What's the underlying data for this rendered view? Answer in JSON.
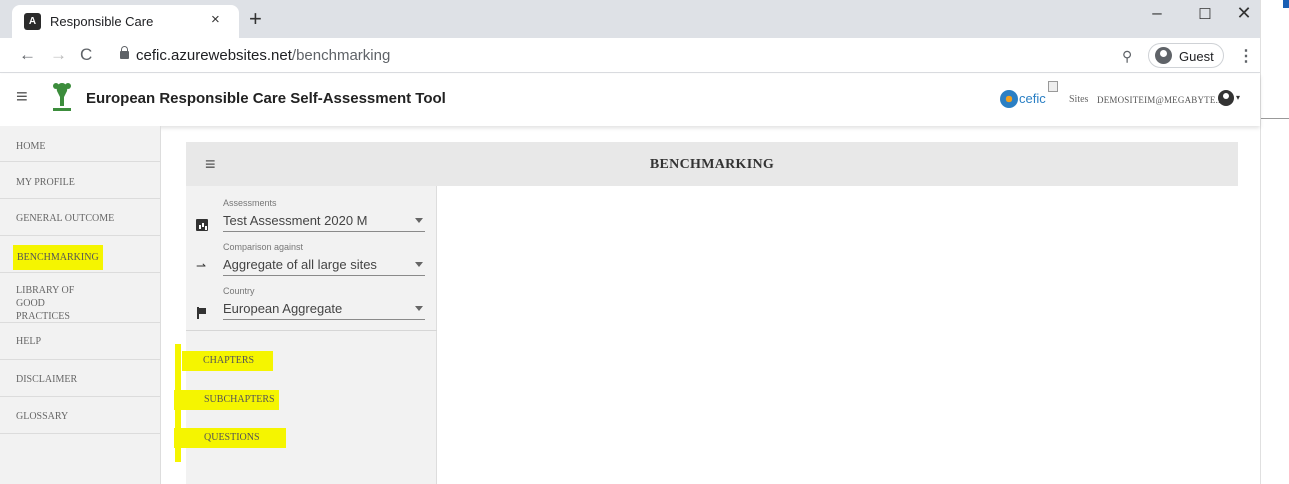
{
  "browser": {
    "tab_title": "Responsible Care",
    "tab_close": "×",
    "new_tab": "+",
    "url_host": "cefic.azurewebsites.net",
    "url_path": "/benchmarking",
    "profile_label": "Guest",
    "controls": {
      "minimize": "–",
      "maximize": "☐",
      "close": "✕",
      "back": "←",
      "forward": "→",
      "reload": "C",
      "zoom": "🔍",
      "menu": "⋮"
    }
  },
  "header": {
    "menu_icon": "≡",
    "title": "European Responsible Care Self-Assessment Tool",
    "cefic_text": "cefic",
    "sites_label": "Sites",
    "user_email": "DEMOSITEIM@MEGABYTE.BE",
    "user_caret": "▾"
  },
  "sidebar": {
    "items": [
      {
        "label": "HOME"
      },
      {
        "label": "MY PROFILE"
      },
      {
        "label": "GENERAL OUTCOME"
      },
      {
        "label": "BENCHMARKING",
        "active": true
      },
      {
        "label": "LIBRARY OF GOOD PRACTICES"
      },
      {
        "label": "HELP"
      },
      {
        "label": "DISCLAIMER"
      },
      {
        "label": "GLOSSARY"
      }
    ]
  },
  "main": {
    "menu_icon": "≡",
    "title": "BENCHMARKING",
    "filters": {
      "assessments": {
        "label": "Assessments",
        "value": "Test Assessment 2020 M",
        "icon": "chart-icon"
      },
      "comparison": {
        "label": "Comparison against",
        "value": "Aggregate of all large sites",
        "icon": "compare-arrows-icon",
        "glyph": "⇀"
      },
      "country": {
        "label": "Country",
        "value": "European Aggregate",
        "icon": "flag-icon"
      }
    },
    "links": {
      "chapters": "CHAPTERS",
      "subchapters": "SUBCHAPTERS",
      "questions": "QUESTIONS"
    }
  },
  "colors": {
    "highlight": "#f5f500",
    "sidebar_bg": "#f2f2f2",
    "title_bar_bg": "#e8e8e8",
    "cefic_blue": "#2a7fc4"
  }
}
